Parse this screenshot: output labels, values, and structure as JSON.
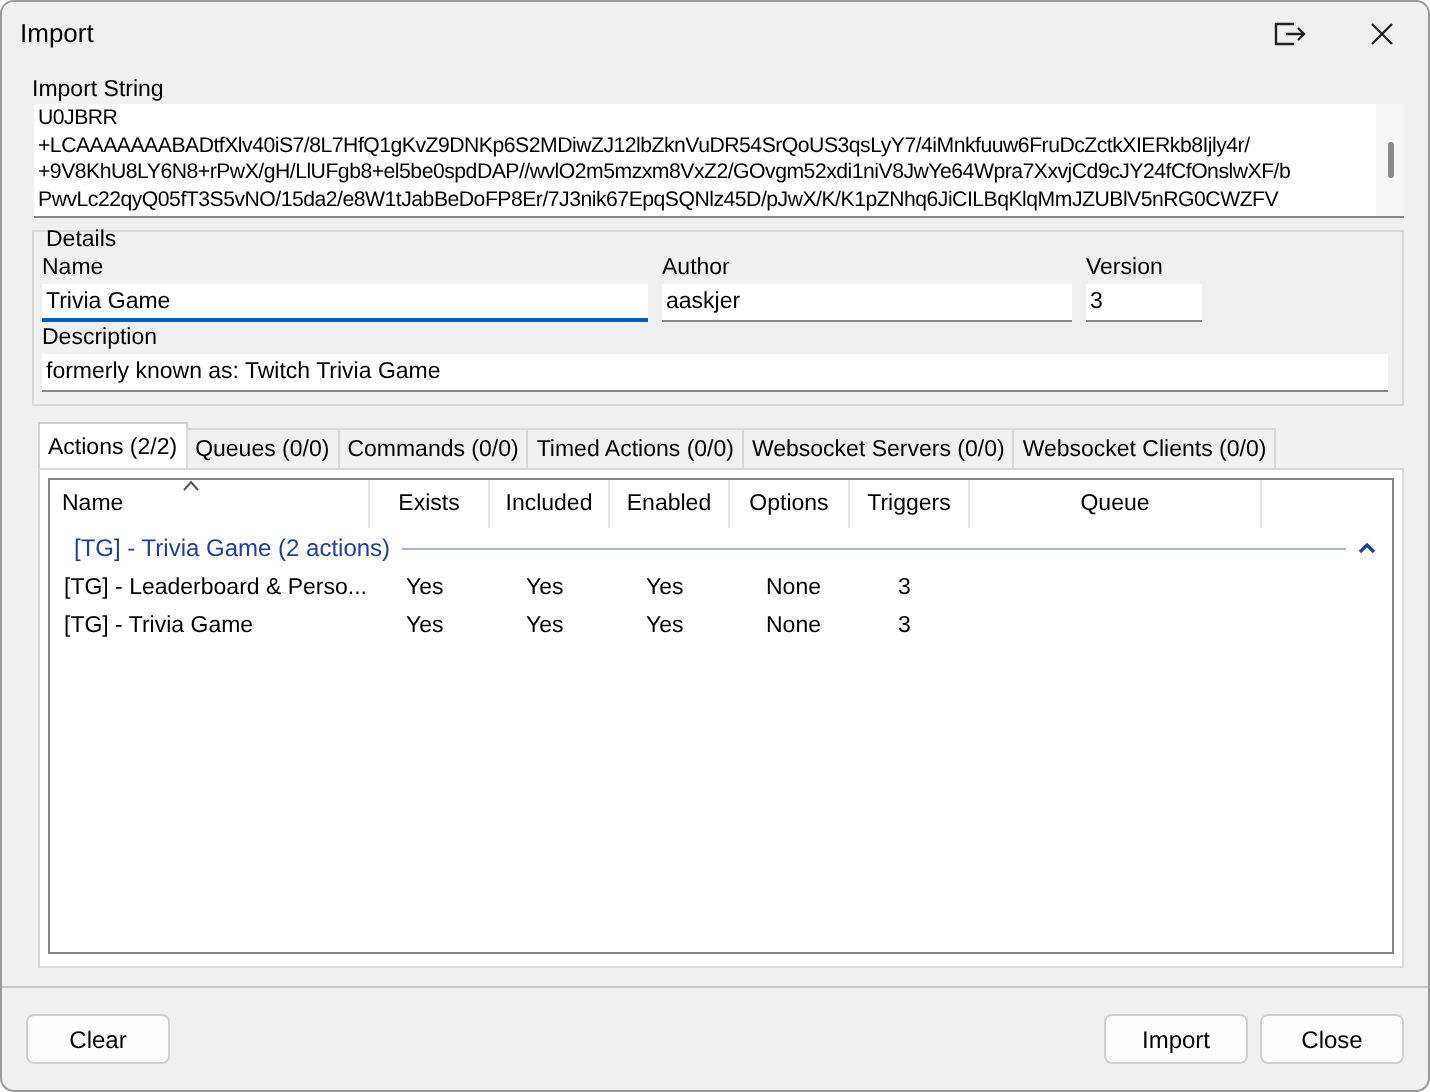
{
  "window": {
    "title": "Import"
  },
  "import_string": {
    "label": "Import String",
    "lines": [
      "U0JBRR",
      "+LCAAAAAAABADtfXlv40iS7/8L7HfQ1gKvZ9DNKp6S2MDiwZJ12lbZknVuDR54SrQoUS3qsLyY7/4iMnkfuuw6FruDcZctkXIERkb8Ijly4r/",
      "+9V8KhU8LY6N8+rPwX/gH/LlUFgb8+el5be0spdDAP//wvlO2m5mzxm8VxZ2/GOvgm52xdi1niV8JwYe64Wpra7XxvjCd9cJY24fCfOnslwXF/b",
      "PwvLc22qyQ05fT3S5vNO/15da2/e8W1tJabBeDoFP8Er/7J3nik67EpqSQNlz45D/pJwX/K/K1pZNhq6JiCILBqKlqMmJZUBlV5nRG0CWZFV"
    ]
  },
  "details": {
    "title": "Details",
    "name": {
      "label": "Name",
      "value": "Trivia Game",
      "focused": true
    },
    "author": {
      "label": "Author",
      "value": "aaskjer",
      "focused": false
    },
    "version": {
      "label": "Version",
      "value": "3",
      "focused": false
    },
    "description": {
      "label": "Description",
      "value": "formerly known as: Twitch Trivia Game",
      "focused": false
    }
  },
  "tabs": [
    {
      "label": "Actions (2/2)",
      "selected": true
    },
    {
      "label": "Queues (0/0)",
      "selected": false
    },
    {
      "label": "Commands (0/0)",
      "selected": false
    },
    {
      "label": "Timed Actions (0/0)",
      "selected": false
    },
    {
      "label": "Websocket Servers (0/0)",
      "selected": false
    },
    {
      "label": "Websocket Clients (0/0)",
      "selected": false
    }
  ],
  "table": {
    "columns": [
      "Name",
      "Exists",
      "Included",
      "Enabled",
      "Options",
      "Triggers",
      "Queue"
    ],
    "group": {
      "title": "[TG] - Trivia Game (2 actions)",
      "expanded": true
    },
    "rows": [
      [
        "[TG] - Leaderboard & Perso...",
        "Yes",
        "Yes",
        "Yes",
        "None",
        "3",
        ""
      ],
      [
        "[TG] - Trivia Game",
        "Yes",
        "Yes",
        "Yes",
        "None",
        "3",
        ""
      ]
    ]
  },
  "buttons": {
    "left": [
      "Clear"
    ],
    "right": [
      "Import",
      "Close"
    ]
  }
}
